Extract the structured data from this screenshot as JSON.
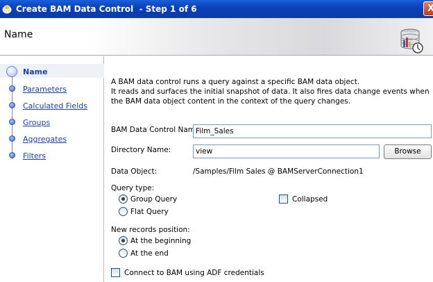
{
  "window": {
    "title": "Create BAM Data Control  - Step 1 of 6",
    "close_label": "X"
  },
  "header": {
    "heading": "Name"
  },
  "nav": {
    "items": [
      {
        "label": "Name",
        "current": true
      },
      {
        "label": "Parameters"
      },
      {
        "label": "Calculated Fields"
      },
      {
        "label": "Groups"
      },
      {
        "label": "Aggregates"
      },
      {
        "label": "Filters"
      }
    ]
  },
  "description": {
    "line1": "A BAM data control runs a query against a specific BAM data object.",
    "line2": "It reads and surfaces the initial snapshot of data. It also fires data change events when the BAM data object content in the context of the query changes."
  },
  "form": {
    "control_name_label": "BAM Data Control Name:",
    "control_name_value": "Film_Sales",
    "directory_label": "Directory Name:",
    "directory_value": "view",
    "browse_label": "Browse",
    "data_object_label": "Data Object:",
    "data_object_value": "/Samples/Film Sales @ BAMServerConnection1",
    "query_type_label": "Query type:",
    "query_group": "Group Query",
    "query_flat": "Flat Query",
    "collapsed_label": "Collapsed",
    "new_records_label": "New records position:",
    "at_beginning": "At the beginning",
    "at_end": "At the end",
    "adf_label": "Connect to BAM using ADF credentials"
  }
}
